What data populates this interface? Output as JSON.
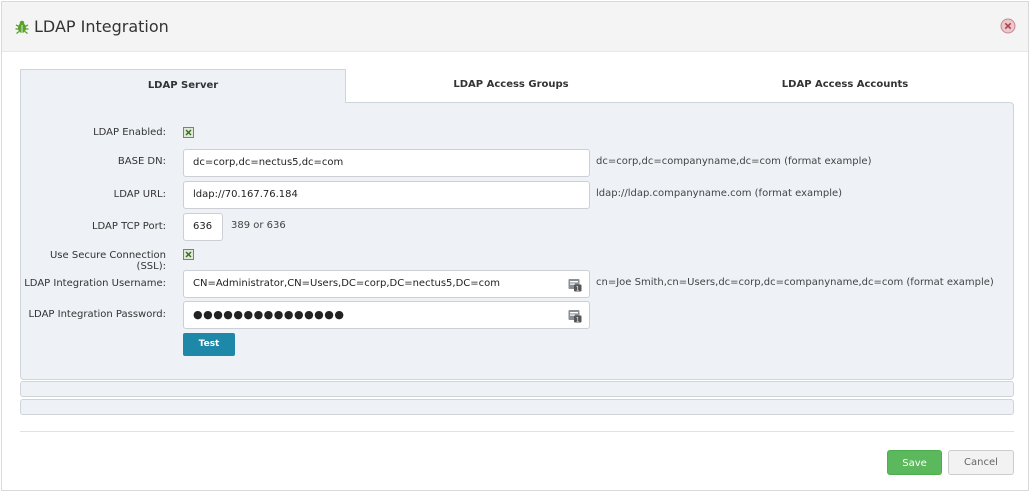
{
  "window": {
    "title": "LDAP Integration",
    "title_icon": "bug-icon",
    "close_icon": "close-circle-icon"
  },
  "tabs": [
    {
      "label": "LDAP Server",
      "active": true
    },
    {
      "label": "LDAP Access Groups",
      "active": false
    },
    {
      "label": "LDAP Access Accounts",
      "active": false
    }
  ],
  "form": {
    "ldap_enabled": {
      "label": "LDAP Enabled:",
      "checked": true
    },
    "base_dn": {
      "label": "BASE DN:",
      "value": "dc=corp,dc=nectus5,dc=com",
      "hint": "dc=corp,dc=companyname,dc=com (format example)"
    },
    "ldap_url": {
      "label": "LDAP URL:",
      "value": "ldap://70.167.76.184",
      "hint": "ldap://ldap.companyname.com (format example)"
    },
    "tcp_port": {
      "label": "LDAP TCP Port:",
      "value": "636",
      "hint": "389 or 636"
    },
    "ssl": {
      "label": "Use Secure Connection (SSL):",
      "checked": true
    },
    "username": {
      "label": "LDAP Integration Username:",
      "value": "CN=Administrator,CN=Users,DC=corp,DC=nectus5,DC=com",
      "hint": "cn=Joe Smith,cn=Users,dc=corp,dc=companyname,dc=com (format example)",
      "icon": "credential-icon"
    },
    "password": {
      "label": "LDAP Integration Password:",
      "value": "●●●●●●●●●●●●●●●",
      "icon": "credential-icon"
    },
    "test_label": "Test"
  },
  "footer": {
    "save_label": "Save",
    "cancel_label": "Cancel"
  },
  "colors": {
    "accent_blue": "#1e88a8",
    "save_green": "#5cb85c",
    "panel_bg": "#eef1f6"
  }
}
